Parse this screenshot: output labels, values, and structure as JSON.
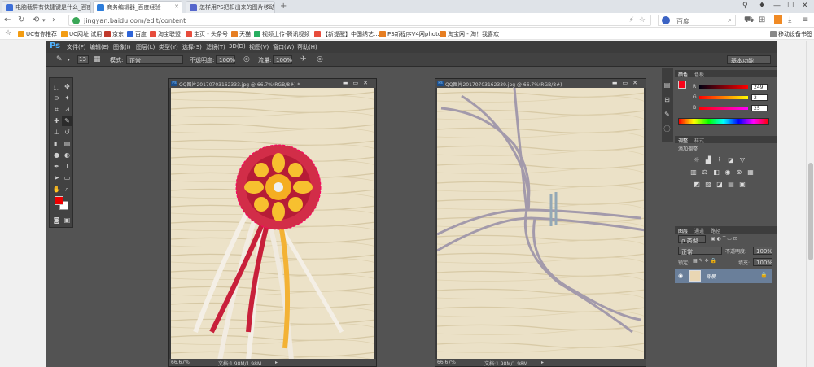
{
  "browser": {
    "tabs": [
      {
        "label": "电脑截屏有快捷键是什么_百度..."
      },
      {
        "label": "商务编辑器_百度经验"
      },
      {
        "label": "怎样用PS把扣出来的图片移动..."
      }
    ],
    "new_tab": "+",
    "url": "jingyan.baidu.com/edit/content",
    "search_engine": "百度",
    "bookmarks": [
      {
        "label": "UC有你推荐",
        "color": "#f39c12"
      },
      {
        "label": "UC网址 试用",
        "color": "#f39c12"
      },
      {
        "label": "京东",
        "color": "#c0392b"
      },
      {
        "label": "百度",
        "color": "#2e64d8"
      },
      {
        "label": "淘宝联盟",
        "color": "#e74c3c"
      },
      {
        "label": "主页 - 头条号",
        "color": "#e74c3c"
      },
      {
        "label": "天猫",
        "color": "#e67e22"
      },
      {
        "label": "视频上传-腾讯视频",
        "color": "#27ae60"
      },
      {
        "label": "【新提醒】中国绣艺...",
        "color": "#e74c3c"
      },
      {
        "label": "PS新程序V4网photo...",
        "color": "#e67e22"
      },
      {
        "label": "淘宝网 - 淘！我喜欢",
        "color": "#e67e22"
      }
    ],
    "mobile_bookmarks": "移动设备书签"
  },
  "ps": {
    "logo": "Ps",
    "menus": [
      "文件(F)",
      "编辑(E)",
      "图像(I)",
      "图层(L)",
      "类型(Y)",
      "选择(S)",
      "滤镜(T)",
      "3D(D)",
      "视图(V)",
      "窗口(W)",
      "帮助(H)"
    ],
    "options": {
      "brush_size": "13",
      "mode_label": "模式:",
      "mode_value": "正常",
      "opacity_label": "不透明度:",
      "opacity_value": "100%",
      "flow_label": "流量:",
      "flow_value": "100%"
    },
    "workspace": "基本功能",
    "docs": [
      {
        "title": "QQ图片20170703162333.jpg @ 66.7%(RGB/8#) *",
        "zoom": "66.67%",
        "doc_info": "文档:1.98M/1.98M"
      },
      {
        "title": "QQ图片20170703162339.jpg @ 66.7%(RGB/8#)",
        "zoom": "66.67%",
        "doc_info": "文档:1.98M/1.98M"
      }
    ],
    "color_panel": {
      "tabs": [
        "颜色",
        "色板"
      ],
      "channels": [
        {
          "label": "R",
          "value": "249"
        },
        {
          "label": "G",
          "value": "2"
        },
        {
          "label": "B",
          "value": "25"
        }
      ]
    },
    "adjust_panel": {
      "tabs": [
        "调整",
        "样式"
      ],
      "title": "添加调整"
    },
    "layers_panel": {
      "tabs": [
        "图层",
        "通道",
        "路径"
      ],
      "filter_label": "ρ 类型",
      "blend_mode": "正常",
      "opacity_label": "不透明度:",
      "opacity_value": "100%",
      "lock_label": "锁定:",
      "fill_label": "填充:",
      "fill_value": "100%",
      "layer_name": "背景"
    }
  }
}
